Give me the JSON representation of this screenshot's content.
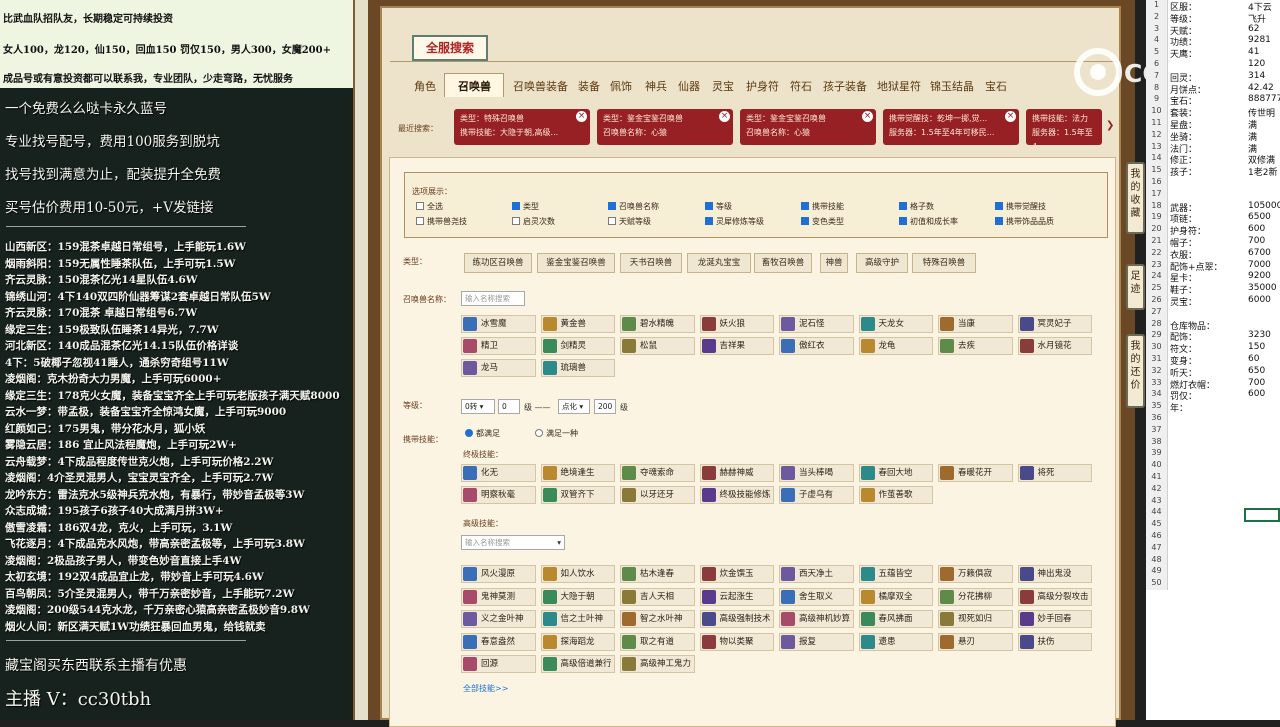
{
  "overlay": {
    "top": [
      "比武血队招队友，长期稳定可持续投资",
      "女人100，龙120，仙150，回血150 罚仅150，男人300，女魔200+",
      "成品号或有意投资都可以联系我，专业团队，少走弯路，无忧服务"
    ],
    "big": [
      "一个免费么么哒卡永久蓝号",
      "专业找号配号，费用100服务到脱坑",
      "找号找到满意为止，配装提升全免费",
      "买号估价费用10-50元，+V发链接"
    ],
    "list": [
      "山西新区：159混茶卓越日常组号，上手能玩1.6W",
      "烟雨斜阳：159无属性睡茶队伍，上手可玩1.5W",
      "齐云灵脉：150混茶亿光14星队伍4.6W",
      "锦绣山河：4下140双四阶仙器筹谋2套卓越日常队伍5W",
      "齐云灵脉：170混茶 卓越日常组号6.7W",
      "缘定三生：159极致队伍睡茶14异光，7.7W",
      "河北新区：140成品混茶亿光14.15队伍价格详谈",
      "4下：5破椰子忽视41睡人，通杀穷奇组号11W",
      "凌烟阁：克木扮奇大力男魔，上手可玩6000+",
      "缘定三生：178克火女魔，装备宝宝齐全上手可玩老版孩子满天赋8000",
      "云水一梦：带孟极，装备宝宝齐全惊鸿女魔，上手可玩9000",
      "红颜如己：175男鬼，带分花水月，狐小妖",
      "雾隐云居：186 宜止风法程魔炮，上手可玩2W+",
      "云舟载梦：4下成品程度传世克火炮，上手可玩价格2.2W",
      "凌烟阁：4介圣灵混男人，宝宝灵宝齐全，上手可玩2.7W",
      "龙吟东方：雷法克水5级神兵克水炮，有暴行，带妙音孟极等3W",
      "众志成城：195孩子6孩子40大成满月拼3W+",
      "傲雪凌霜：186双4龙，克火，上手可玩，3.1W",
      "飞花逐月：4下成品克水风炮，带高亲密孟极等，上手可玩3.8W",
      "凌烟阁：2极品孩子男人，带变色妙音直接上手4W",
      "太初玄境：192双4成品宜止龙，带妙音上手可玩4.6W",
      "百鸟朝凤：5介圣灵混男人，带千万亲密妙音，上手能玩7.2W",
      "凌烟阁：200级544克水龙，千万亲密心猿高亲密孟极妙音9.8W",
      "烟火人间：新区满天赋1W功绩狂暴回血男鬼，给钱就卖"
    ],
    "footer1": "藏宝阁买东西联系主播有优惠",
    "footer2": "主播 V：cc30tbh"
  },
  "game": {
    "title": "全服搜索",
    "tabs": [
      "角色",
      "召唤兽",
      "召唤兽装备",
      "装备",
      "佩饰",
      "神兵",
      "仙器",
      "灵宝",
      "护身符",
      "符石",
      "孩子装备",
      "地狱星符",
      "锦玉结晶",
      "宝石"
    ],
    "recent_label": "最近搜索：",
    "recent": [
      {
        "l1": "类型：特殊召唤兽",
        "l2": "携带技能：大隐于朝,高级..."
      },
      {
        "l1": "类型：鉴金宝鉴召唤兽",
        "l2": "召唤兽名称：心猿"
      },
      {
        "l1": "类型：鉴金宝鉴召唤兽",
        "l2": "召唤兽名称：心猿"
      },
      {
        "l1": "携带觉醒技：乾坤一掷,觉...",
        "l2": "服务器：1.5年至4年可移民..."
      },
      {
        "l1": "携带技能：法力",
        "l2": "服务器：1.5年至4"
      }
    ],
    "options_title": "选项展示：",
    "options": [
      {
        "label": "全选",
        "on": false
      },
      {
        "label": "类型",
        "on": true
      },
      {
        "label": "召唤兽名称",
        "on": true
      },
      {
        "label": "等级",
        "on": true
      },
      {
        "label": "携带技能",
        "on": true
      },
      {
        "label": "格子数",
        "on": true
      },
      {
        "label": "携带觉醒技",
        "on": true
      },
      {
        "label": "携带兽尧技",
        "on": false
      },
      {
        "label": "启灵次数",
        "on": false
      },
      {
        "label": "天赋等级",
        "on": false
      },
      {
        "label": "灵犀修炼等级",
        "on": true
      },
      {
        "label": "变色类型",
        "on": true
      },
      {
        "label": "初值和成长率",
        "on": true
      },
      {
        "label": "携带饰品品质",
        "on": true
      }
    ],
    "type_label": "类型：",
    "types": [
      "练功区召唤兽",
      "鉴金宝鉴召唤兽",
      "天书召唤兽",
      "龙涎丸宝宝",
      "畜牧召唤兽",
      "神兽",
      "高级守护",
      "特殊召唤兽"
    ],
    "name_label": "召唤兽名称：",
    "name_placeholder": "输入名称搜索",
    "pets": [
      "冰雪魔",
      "黄金兽",
      "碧水精魄",
      "妖火狼",
      "泥石怪",
      "天龙女",
      "当康",
      "冥灵妃子",
      "精卫",
      "剑精灵",
      "松鼠",
      "吉祥果",
      "傲红衣",
      "龙龟",
      "去疾",
      "水月镜花",
      "龙马",
      "琉璃兽"
    ],
    "level_label": "等级：",
    "level": {
      "sel1": "0转",
      "v1": "0",
      "mid1": "级 ——",
      "sel2": "点化",
      "v2": "200",
      "mid2": "级"
    },
    "skill_label": "携带技能：",
    "radio1": "都满足",
    "radio2": "满足一种",
    "final_label": "终极技能：",
    "final_skills": [
      "化无",
      "绝境逢生",
      "夺魂索命",
      "赫赫神威",
      "当头棒喝",
      "春回大地",
      "春暖花开",
      "将死",
      "明察秋毫",
      "双管齐下",
      "以牙还牙",
      "终极技能修炼",
      "子虚乌有",
      "作茧善歌"
    ],
    "high_label": "高级技能：",
    "high_placeholder": "输入名称搜索",
    "high_skills": [
      "风火漫原",
      "如人饮水",
      "枯木逢春",
      "炊金馔玉",
      "西天净土",
      "五蕴皆空",
      "万籁俱寂",
      "神出鬼没",
      "鬼神莫测",
      "大隐于朝",
      "吉人天相",
      "云起涨生",
      "舍生取义",
      "橘摩双全",
      "分花拂柳",
      "高级分裂攻击",
      "义之金叶神",
      "信之土叶神",
      "智之水叶神",
      "高级强制技术",
      "高级神机妙算",
      "春风拂面",
      "视死如归",
      "妙手回春",
      "春意盎然",
      "探海蹈龙",
      "取之有道",
      "物以类聚",
      "报复",
      "遗患",
      "悬刃",
      "扶伤",
      "回源",
      "高级倍道兼行",
      "高级神工鬼力"
    ],
    "all_skills": "全部技能>>",
    "side_tabs": [
      "我的收藏",
      "足迹",
      "我的还价"
    ]
  },
  "sheet": {
    "rows": [
      {
        "n": "1",
        "k": "区服：",
        "v": "4下云"
      },
      {
        "n": "2",
        "k": "等级：",
        "v": "飞升"
      },
      {
        "n": "3",
        "k": "天赋：",
        "v": "62"
      },
      {
        "n": "4",
        "k": "功绩：",
        "v": "9281"
      },
      {
        "n": "5",
        "k": "天鹰：",
        "v": "41"
      },
      {
        "n": "6",
        "k": "",
        "v": "120"
      },
      {
        "n": "7",
        "k": "回灵：",
        "v": "314"
      },
      {
        "n": "8",
        "k": "月饼点：",
        "v": "42.42"
      },
      {
        "n": "9",
        "k": "宝石：",
        "v": "888777"
      },
      {
        "n": "10",
        "k": "套装：",
        "v": "传世明"
      },
      {
        "n": "11",
        "k": "星盘：",
        "v": "满"
      },
      {
        "n": "12",
        "k": "坐骑：",
        "v": "满"
      },
      {
        "n": "13",
        "k": "法门：",
        "v": "满"
      },
      {
        "n": "14",
        "k": "修正：",
        "v": "双修满"
      },
      {
        "n": "15",
        "k": "孩子：",
        "v": "1老2新"
      },
      {
        "n": "16",
        "k": "",
        "v": ""
      },
      {
        "n": "17",
        "k": "",
        "v": ""
      },
      {
        "n": "18",
        "k": "武器：",
        "v": "105000"
      },
      {
        "n": "19",
        "k": "项链：",
        "v": "6500"
      },
      {
        "n": "20",
        "k": "护身符：",
        "v": "600"
      },
      {
        "n": "21",
        "k": "帽子：",
        "v": "700"
      },
      {
        "n": "22",
        "k": "衣服：",
        "v": "6700"
      },
      {
        "n": "23",
        "k": "配饰+点翠：",
        "v": "7000"
      },
      {
        "n": "24",
        "k": "星卡：",
        "v": "9200"
      },
      {
        "n": "25",
        "k": "鞋子：",
        "v": "35000"
      },
      {
        "n": "26",
        "k": "灵宝：",
        "v": "6000"
      },
      {
        "n": "27",
        "k": "",
        "v": ""
      },
      {
        "n": "28",
        "k": "仓库物品：",
        "v": ""
      },
      {
        "n": "29",
        "k": "配饰：",
        "v": "3230"
      },
      {
        "n": "30",
        "k": "符文：",
        "v": "150"
      },
      {
        "n": "31",
        "k": "变身：",
        "v": "60"
      },
      {
        "n": "32",
        "k": "听天：",
        "v": "650"
      },
      {
        "n": "33",
        "k": "燃灯衣帽：",
        "v": "700"
      },
      {
        "n": "34",
        "k": "罚仅：",
        "v": "600"
      },
      {
        "n": "35",
        "k": "年：",
        "v": ""
      },
      {
        "n": "36",
        "k": "",
        "v": ""
      },
      {
        "n": "37",
        "k": "",
        "v": ""
      },
      {
        "n": "38",
        "k": "",
        "v": ""
      },
      {
        "n": "39",
        "k": "",
        "v": ""
      },
      {
        "n": "40",
        "k": "",
        "v": ""
      },
      {
        "n": "41",
        "k": "",
        "v": ""
      },
      {
        "n": "42",
        "k": "",
        "v": ""
      },
      {
        "n": "43",
        "k": "",
        "v": ""
      },
      {
        "n": "44",
        "k": "",
        "v": ""
      },
      {
        "n": "45",
        "k": "",
        "v": ""
      },
      {
        "n": "46",
        "k": "",
        "v": ""
      },
      {
        "n": "47",
        "k": "",
        "v": ""
      },
      {
        "n": "48",
        "k": "",
        "v": ""
      },
      {
        "n": "49",
        "k": "",
        "v": ""
      },
      {
        "n": "50",
        "k": "",
        "v": ""
      }
    ]
  },
  "watermark": "CC直播",
  "colors": {
    "recent_bg": "#962024",
    "accent_red": "#b02323",
    "checkbox_on": "#1f6fd6"
  }
}
